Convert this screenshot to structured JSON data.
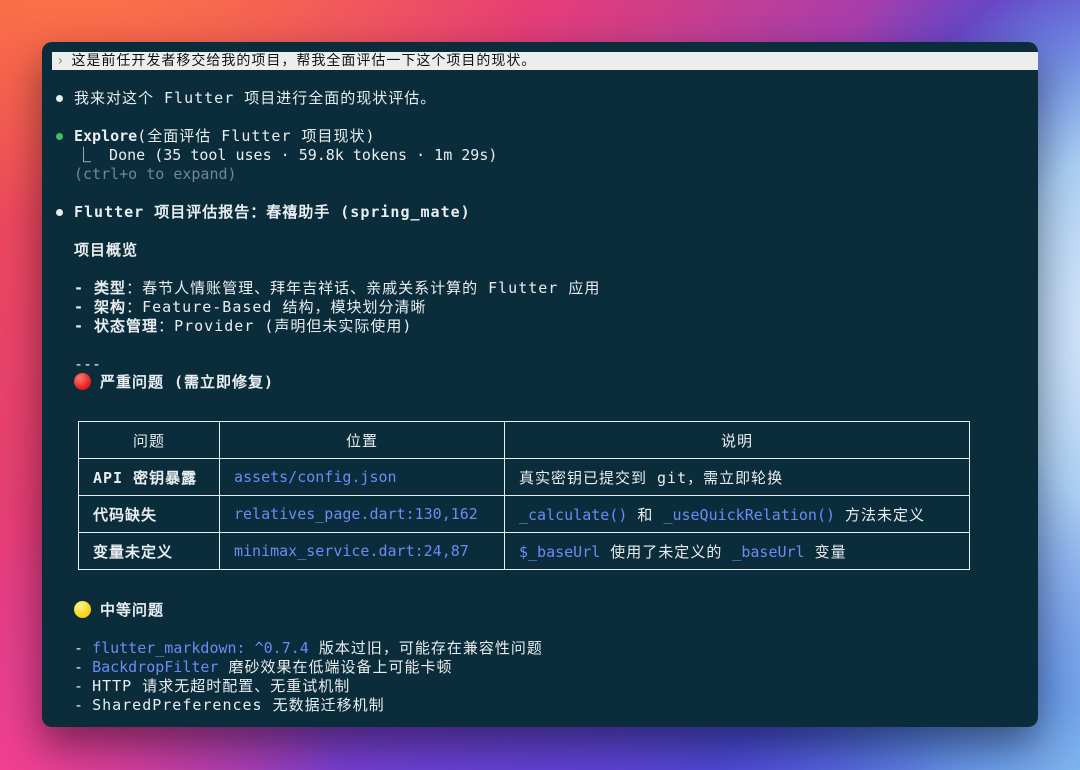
{
  "prompt": {
    "chevron": "›",
    "text": "这是前任开发者移交给我的项目，帮我全面评估一下这个项目的现状。"
  },
  "messages": {
    "intro": "我来对这个 Flutter 项目进行全面的现状评估。",
    "tool": {
      "name": "Explore",
      "args": "(全面评估 Flutter 项目现状)",
      "result": "⎿  Done (35 tool uses · 59.8k tokens · 1m 29s)",
      "expand_hint": "(ctrl+o to expand)"
    },
    "report_title": "Flutter 项目评估报告：春禧助手 (spring_mate)"
  },
  "overview": {
    "heading": "项目概览",
    "items": [
      {
        "label": "- 类型",
        "value": "：春节人情账管理、拜年吉祥话、亲戚关系计算的 Flutter 应用"
      },
      {
        "label": "- 架构",
        "value": "：Feature-Based 结构，模块划分清晰"
      },
      {
        "label": "- 状态管理",
        "value": "：Provider (声明但未实际使用)"
      }
    ]
  },
  "separator": "---",
  "critical": {
    "heading": "严重问题 (需立即修复)",
    "icon": "red-circle",
    "columns": [
      "问题",
      "位置",
      "说明"
    ],
    "rows": [
      {
        "issue": "API 密钥暴露",
        "location": "assets/config.json",
        "desc": [
          {
            "t": "真实密钥已提交到 git，需立即轮换"
          }
        ]
      },
      {
        "issue": "代码缺失",
        "location": "relatives_page.dart:130,162",
        "desc": [
          {
            "t": "_calculate()",
            "code": true
          },
          {
            "t": " 和 "
          },
          {
            "t": "_useQuickRelation()",
            "code": true
          },
          {
            "t": " 方法未定义"
          }
        ]
      },
      {
        "issue": "变量未定义",
        "location": "minimax_service.dart:24,87",
        "desc": [
          {
            "t": "$_baseUrl",
            "code": true
          },
          {
            "t": " 使用了未定义的 "
          },
          {
            "t": "_baseUrl",
            "code": true
          },
          {
            "t": " 变量"
          }
        ]
      }
    ]
  },
  "moderate": {
    "heading": "中等问题",
    "icon": "yellow-circle",
    "items": [
      {
        "code": "flutter_markdown: ^0.7.4",
        "text": " 版本过旧，可能存在兼容性问题"
      },
      {
        "code": "BackdropFilter",
        "text": " 磨砂效果在低端设备上可能卡顿"
      },
      {
        "code": "",
        "text": "HTTP 请求无超时配置、无重试机制"
      },
      {
        "code": "",
        "text": "SharedPreferences 无数据迁移机制"
      }
    ]
  },
  "colors": {
    "terminal_bg": "#0b2c3a",
    "text": "#e8edf0",
    "code": "#6a8cf5",
    "dim": "#6f8893",
    "bullet_active": "#3ec15a"
  }
}
